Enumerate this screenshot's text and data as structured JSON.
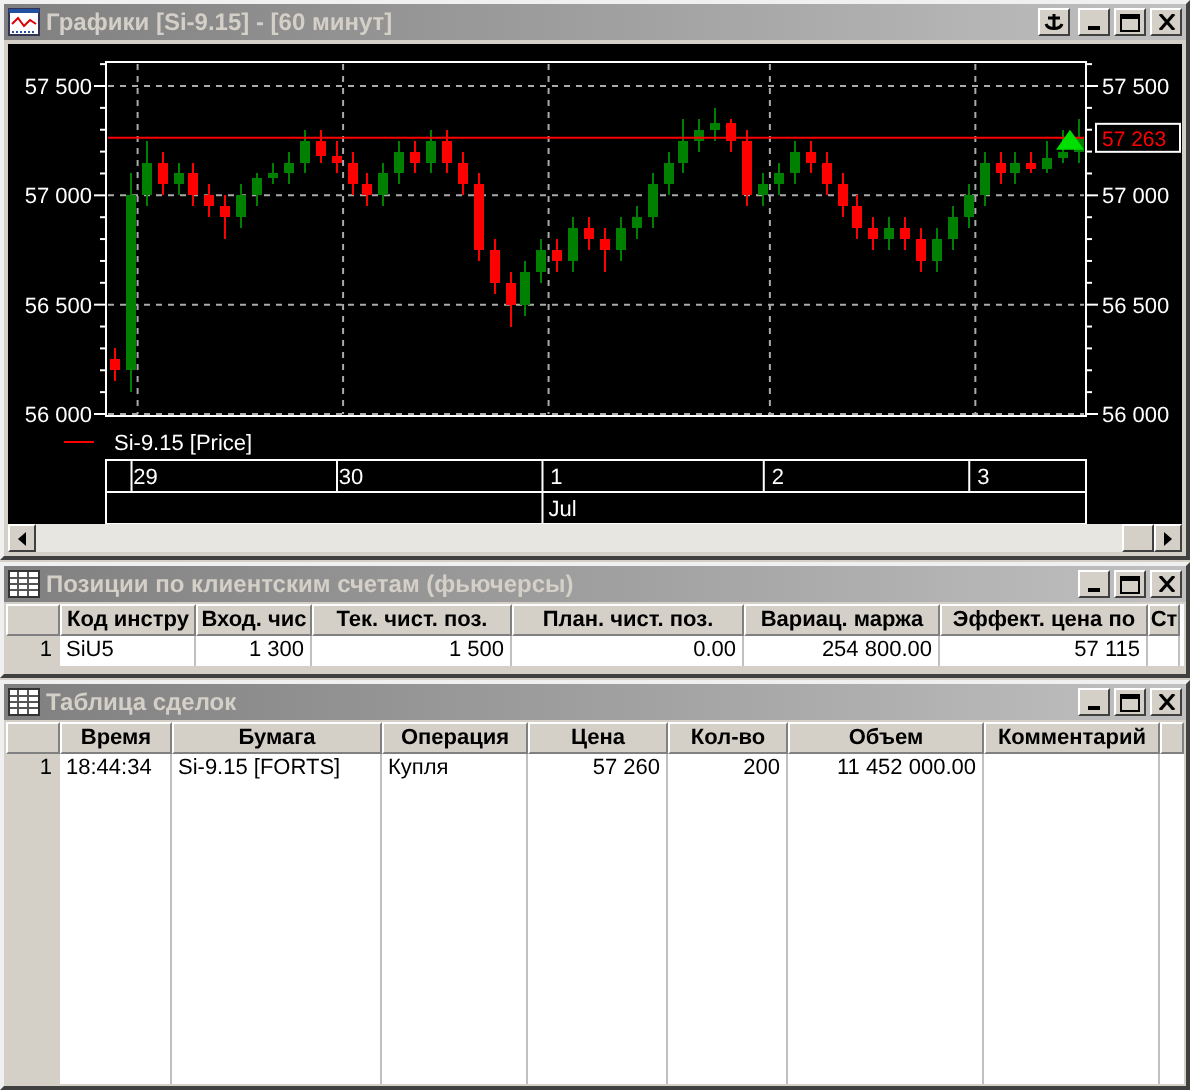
{
  "chart_window": {
    "title": "Графики [Si-9.15] - [60 минут]",
    "y_axis_right": [
      "57 500",
      "57 000",
      "56 500",
      "56 000"
    ],
    "last_price": "57 263",
    "legend": "Si-9.15 [Price]",
    "month": "Jul",
    "chart_data": {
      "type": "candlestick",
      "grid": true,
      "ylim": [
        56000,
        57500
      ],
      "yticks": [
        {
          "value": 57500,
          "label": "57 500"
        },
        {
          "value": 57000,
          "label": "57 000"
        },
        {
          "value": 56500,
          "label": "56 500"
        },
        {
          "value": 56000,
          "label": "56 000"
        }
      ],
      "ref_lines": [
        {
          "axis": "y",
          "value": 57263,
          "color": "#ff0000"
        }
      ],
      "categories": [
        null,
        null,
        "29",
        null,
        null,
        null,
        null,
        null,
        null,
        null,
        null,
        null,
        null,
        null,
        null,
        "30",
        null,
        null,
        null,
        null,
        null,
        null,
        null,
        null,
        null,
        null,
        null,
        null,
        "1",
        null,
        null,
        null,
        null,
        null,
        null,
        null,
        null,
        null,
        null,
        null,
        null,
        null,
        "2",
        null,
        null,
        null,
        null,
        null,
        null,
        null,
        null,
        null,
        null,
        null,
        null,
        "3",
        null,
        null,
        null,
        null,
        null,
        null
      ],
      "ohlc": [
        [
          56250,
          56300,
          56150,
          56200
        ],
        [
          56200,
          57100,
          56100,
          57000
        ],
        [
          57000,
          57250,
          56950,
          57150
        ],
        [
          57150,
          57200,
          57000,
          57050
        ],
        [
          57050,
          57150,
          57000,
          57100
        ],
        [
          57100,
          57150,
          56950,
          57000
        ],
        [
          57000,
          57050,
          56900,
          56950
        ],
        [
          56950,
          57000,
          56800,
          56900
        ],
        [
          56900,
          57050,
          56850,
          57000
        ],
        [
          57000,
          57100,
          56950,
          57080
        ],
        [
          57080,
          57150,
          57050,
          57100
        ],
        [
          57100,
          57200,
          57050,
          57150
        ],
        [
          57150,
          57300,
          57100,
          57250
        ],
        [
          57250,
          57300,
          57150,
          57180
        ],
        [
          57180,
          57250,
          57100,
          57150
        ],
        [
          57150,
          57200,
          57000,
          57050
        ],
        [
          57050,
          57100,
          56950,
          57000
        ],
        [
          57000,
          57150,
          56950,
          57100
        ],
        [
          57100,
          57250,
          57050,
          57200
        ],
        [
          57200,
          57250,
          57100,
          57150
        ],
        [
          57150,
          57300,
          57100,
          57250
        ],
        [
          57250,
          57300,
          57100,
          57150
        ],
        [
          57150,
          57200,
          57000,
          57050
        ],
        [
          57050,
          57100,
          56700,
          56750
        ],
        [
          56750,
          56800,
          56550,
          56600
        ],
        [
          56600,
          56650,
          56400,
          56500
        ],
        [
          56500,
          56700,
          56450,
          56650
        ],
        [
          56650,
          56800,
          56600,
          56750
        ],
        [
          56750,
          56800,
          56650,
          56700
        ],
        [
          56700,
          56900,
          56650,
          56850
        ],
        [
          56850,
          56900,
          56750,
          56800
        ],
        [
          56800,
          56850,
          56650,
          56750
        ],
        [
          56750,
          56900,
          56700,
          56850
        ],
        [
          56850,
          56950,
          56800,
          56900
        ],
        [
          56900,
          57100,
          56850,
          57050
        ],
        [
          57050,
          57200,
          57000,
          57150
        ],
        [
          57150,
          57350,
          57100,
          57250
        ],
        [
          57250,
          57350,
          57200,
          57300
        ],
        [
          57300,
          57400,
          57250,
          57330
        ],
        [
          57330,
          57350,
          57200,
          57250
        ],
        [
          57250,
          57300,
          56950,
          57000
        ],
        [
          57000,
          57100,
          56950,
          57050
        ],
        [
          57050,
          57150,
          57000,
          57100
        ],
        [
          57100,
          57250,
          57050,
          57200
        ],
        [
          57200,
          57250,
          57100,
          57150
        ],
        [
          57150,
          57200,
          57000,
          57050
        ],
        [
          57050,
          57100,
          56900,
          56950
        ],
        [
          56950,
          57000,
          56800,
          56850
        ],
        [
          56850,
          56900,
          56750,
          56800
        ],
        [
          56800,
          56900,
          56750,
          56850
        ],
        [
          56850,
          56900,
          56750,
          56800
        ],
        [
          56800,
          56850,
          56650,
          56700
        ],
        [
          56700,
          56850,
          56650,
          56800
        ],
        [
          56800,
          56950,
          56750,
          56900
        ],
        [
          56900,
          57050,
          56850,
          57000
        ],
        [
          57000,
          57200,
          56950,
          57150
        ],
        [
          57150,
          57200,
          57050,
          57100
        ],
        [
          57100,
          57200,
          57050,
          57150
        ],
        [
          57150,
          57200,
          57100,
          57120
        ],
        [
          57120,
          57250,
          57100,
          57170
        ],
        [
          57170,
          57300,
          57150,
          57200
        ],
        [
          57200,
          57350,
          57150,
          57263
        ]
      ]
    }
  },
  "positions_window": {
    "title": "Позиции по клиентским счетам (фьючерсы)",
    "columns": [
      "Код инстру",
      "Вход. чис",
      "Тек. чист. поз.",
      "План. чист. поз.",
      "Вариац. маржа",
      "Эффект. цена по",
      "Ст"
    ],
    "rows": [
      {
        "number": "1",
        "cells": [
          "SiU5",
          "1 300",
          "1 500",
          "0.00",
          "254 800.00",
          "57 115"
        ]
      }
    ]
  },
  "deals_window": {
    "title": "Таблица сделок",
    "columns": [
      "Время",
      "Бумага",
      "Операция",
      "Цена",
      "Кол-во",
      "Объем",
      "Комментарий"
    ],
    "rows": [
      {
        "number": "1",
        "cells": [
          "18:44:34",
          "Si-9.15 [FORTS]",
          "Купля",
          "57 260",
          "200",
          "11 452 000.00"
        ]
      }
    ]
  }
}
